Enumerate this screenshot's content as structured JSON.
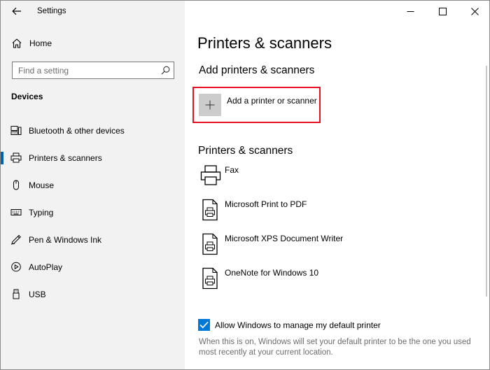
{
  "window": {
    "title": "Settings",
    "controls": {
      "minimize": "minimize",
      "maximize": "maximize",
      "close": "close"
    }
  },
  "sidebar": {
    "home_label": "Home",
    "search_placeholder": "Find a setting",
    "section_title": "Devices",
    "items": [
      {
        "label": "Bluetooth & other devices",
        "icon": "bluetooth-devices-icon",
        "active": false
      },
      {
        "label": "Printers & scanners",
        "icon": "printer-icon",
        "active": true
      },
      {
        "label": "Mouse",
        "icon": "mouse-icon",
        "active": false
      },
      {
        "label": "Typing",
        "icon": "keyboard-icon",
        "active": false
      },
      {
        "label": "Pen & Windows Ink",
        "icon": "pen-icon",
        "active": false
      },
      {
        "label": "AutoPlay",
        "icon": "autoplay-icon",
        "active": false
      },
      {
        "label": "USB",
        "icon": "usb-icon",
        "active": false
      }
    ]
  },
  "main": {
    "page_title": "Printers & scanners",
    "add_section_title": "Add printers & scanners",
    "add_button_label": "Add a printer or scanner",
    "list_section_title": "Printers & scanners",
    "printers": [
      {
        "name": "Fax",
        "icon": "fax-printer-icon"
      },
      {
        "name": "Microsoft Print to PDF",
        "icon": "document-printer-icon"
      },
      {
        "name": "Microsoft XPS Document Writer",
        "icon": "document-printer-icon"
      },
      {
        "name": "OneNote for Windows 10",
        "icon": "document-printer-icon"
      }
    ],
    "default_printer_checkbox": {
      "label": "Allow Windows to manage my default printer",
      "checked": true
    },
    "help_text": "When this is on, Windows will set your default printer to be the one you used most recently at your current location."
  },
  "colors": {
    "accent": "#0078d7",
    "active_indicator": "#0063b1",
    "highlight_border": "#e81123",
    "sidebar_bg": "#f2f2f2"
  }
}
